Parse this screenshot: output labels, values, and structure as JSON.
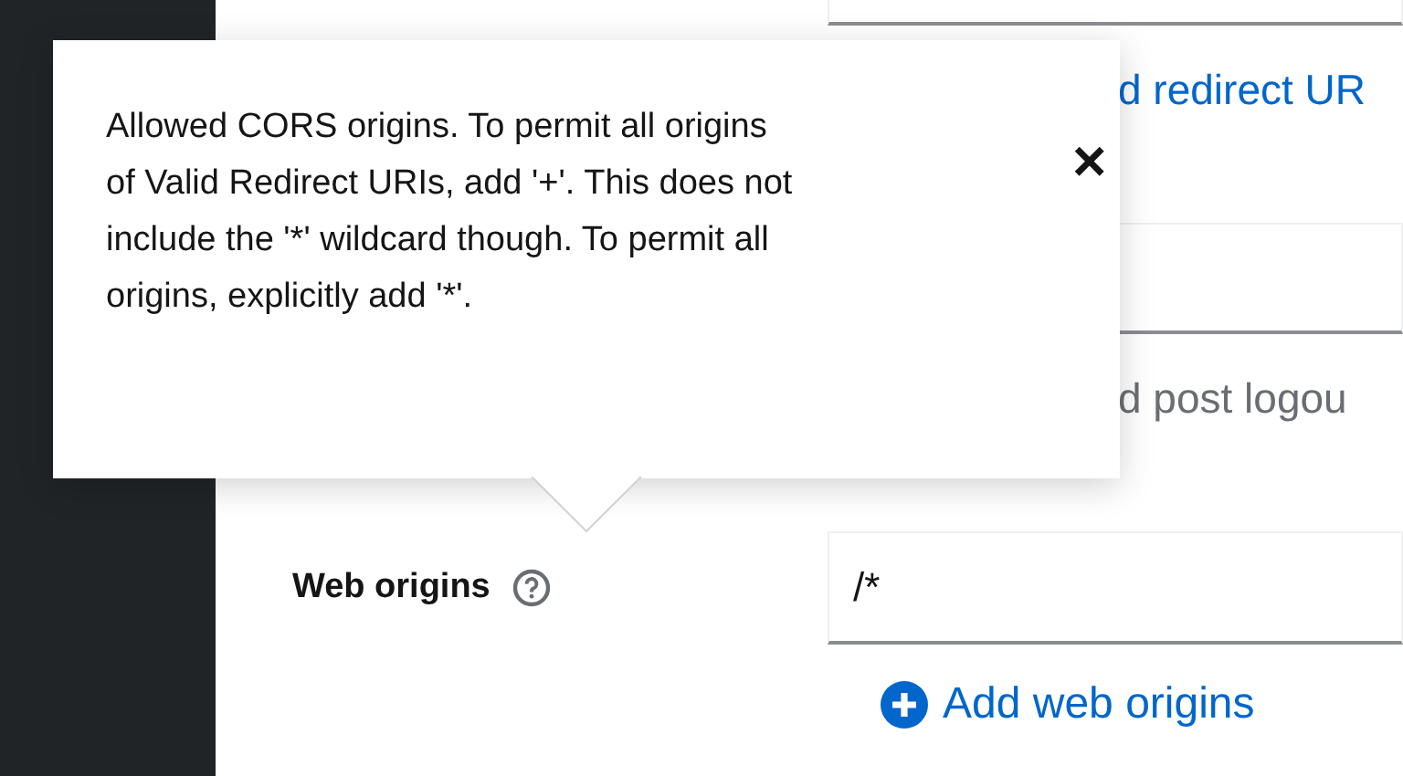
{
  "fields_above": [
    {
      "kind": "field"
    },
    {
      "kind": "link",
      "text": "d redirect UR"
    },
    {
      "kind": "field"
    },
    {
      "kind": "placeholder",
      "text": "d post logou"
    }
  ],
  "web_origins": {
    "label": "Web origins",
    "value": "/*",
    "add_link": "Add web origins"
  },
  "popover": {
    "text": "Allowed CORS origins. To permit all origins of Valid Redirect URIs, add '+'. This does not include the '*' wildcard though. To permit all origins, explicitly add '*'.",
    "close": "×"
  }
}
